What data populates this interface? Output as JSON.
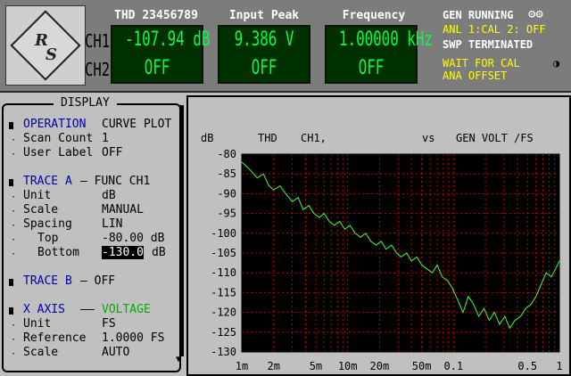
{
  "header": {
    "logo": {
      "text_r": "R",
      "text_s": "S"
    },
    "channels": {
      "ch1": "CH1",
      "ch2": "CH2"
    },
    "meters": [
      {
        "title": "THD 23456789",
        "ch1": "-107.94 dB",
        "ch2": "OFF"
      },
      {
        "title": "Input Peak",
        "ch1": "9.386  V",
        "ch2": "OFF"
      },
      {
        "title": "Frequency",
        "ch1": "1.00000 kHz",
        "ch2": "OFF"
      }
    ],
    "status": {
      "gen": "GEN RUNNING",
      "gen_icons": "⚙⚙",
      "anl": "ANL 1:CAL  2: OFF",
      "swp": "SWP TERMINATED",
      "wait1": "WAIT FOR CAL",
      "wait2": " ANA OFFSET",
      "indicator": "◑"
    }
  },
  "panel": {
    "title": "DISPLAY",
    "rows": [
      {
        "label": "OPERATION",
        "value": "CURVE PLOT",
        "kind": "section"
      },
      {
        "label": "Scan Count",
        "value": "1",
        "kind": "item"
      },
      {
        "label": "User Label",
        "value": "OFF",
        "kind": "item"
      },
      {
        "label": "TRACE A",
        "value": "— FUNC CH1",
        "kind": "section"
      },
      {
        "label": "Unit",
        "value": "dB",
        "kind": "item"
      },
      {
        "label": "Scale",
        "value": "MANUAL",
        "kind": "item"
      },
      {
        "label": "Spacing",
        "value": "LIN",
        "kind": "item"
      },
      {
        "label": "Top",
        "value": "-80.00 dB",
        "kind": "subitem"
      },
      {
        "label": "Bottom",
        "value": "-130.0",
        "unit": "dB",
        "kind": "subitem-edit"
      },
      {
        "label": "TRACE B",
        "value": "— OFF",
        "kind": "section"
      },
      {
        "label": "X AXIS",
        "value": "VOLTAGE",
        "kind": "section-green"
      },
      {
        "label": "Unit",
        "value": "FS",
        "kind": "item"
      },
      {
        "label": "Reference",
        "value": "1.0000 FS",
        "kind": "item"
      },
      {
        "label": "Scale",
        "value": "AUTO",
        "kind": "item"
      }
    ]
  },
  "graph": {
    "header": {
      "unit": "dB",
      "trace": "THD",
      "channel": "CH1,",
      "vs": "vs",
      "xname": "GEN VOLT /FS"
    }
  },
  "colors": {
    "background": "#c0c0c0",
    "plot_bg": "#000000",
    "grid": "#c00000",
    "trace": "#40ff40",
    "meter_text": "#00ff40",
    "status_yellow": "#ffff00"
  },
  "chart_data": {
    "type": "line",
    "title": "THD   CH1,   vs   GEN VOLT /FS",
    "xlabel": "",
    "ylabel": "dB",
    "x_scale": "log",
    "xlim": [
      0.001,
      1
    ],
    "ylim": [
      -130,
      -80
    ],
    "grid": true,
    "y_ticks": [
      "-80",
      "-85",
      "-90",
      "-95",
      "-100",
      "-105",
      "-110",
      "-115",
      "-120",
      "-125",
      "-130"
    ],
    "x_ticks": [
      {
        "value": 0.001,
        "label": "1m"
      },
      {
        "value": 0.002,
        "label": "2m"
      },
      {
        "value": 0.005,
        "label": "5m"
      },
      {
        "value": 0.01,
        "label": "10m"
      },
      {
        "value": 0.02,
        "label": "20m"
      },
      {
        "value": 0.05,
        "label": "50m"
      },
      {
        "value": 0.1,
        "label": "0.1"
      },
      {
        "value": 0.5,
        "label": "0.5"
      },
      {
        "value": 1,
        "label": "1"
      }
    ],
    "series": [
      {
        "x": [
          0.001,
          0.0012,
          0.0014,
          0.0016,
          0.0018,
          0.002,
          0.0023,
          0.0026,
          0.003,
          0.0034,
          0.0038,
          0.0043,
          0.0048,
          0.0054,
          0.006,
          0.0067,
          0.0075,
          0.0084,
          0.0094,
          0.0105,
          0.0118,
          0.0132,
          0.0148,
          0.0165,
          0.0185,
          0.0207,
          0.023,
          0.026,
          0.029,
          0.032,
          0.036,
          0.04,
          0.045,
          0.05,
          0.056,
          0.063,
          0.07,
          0.078,
          0.088,
          0.098,
          0.11,
          0.123,
          0.138,
          0.155,
          0.173,
          0.194,
          0.217,
          0.243,
          0.272,
          0.305,
          0.34,
          0.38,
          0.43,
          0.48,
          0.54,
          0.6,
          0.67,
          0.75,
          0.84,
          0.92,
          1.0
        ],
        "values": [
          -82,
          -84,
          -86,
          -85,
          -88,
          -89,
          -88,
          -90,
          -92,
          -91,
          -94,
          -93,
          -95,
          -96,
          -95,
          -97,
          -98,
          -97,
          -99,
          -98,
          -100,
          -101,
          -100,
          -102,
          -103,
          -102,
          -104,
          -103,
          -105,
          -106,
          -105,
          -107,
          -106,
          -108,
          -109,
          -110,
          -108,
          -111,
          -112,
          -114,
          -117,
          -120,
          -116,
          -118,
          -121,
          -119,
          -122,
          -120,
          -123,
          -121,
          -124,
          -122,
          -121,
          -119,
          -118,
          -116,
          -113,
          -110,
          -111,
          -109,
          -107
        ]
      }
    ]
  }
}
